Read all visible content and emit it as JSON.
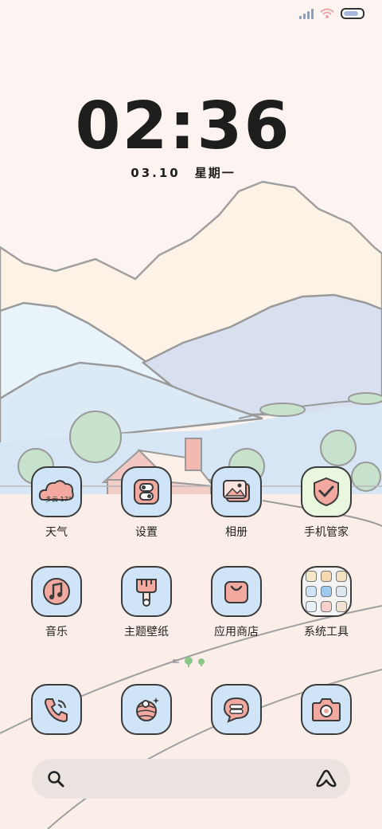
{
  "status_bar": {
    "icons": [
      "signal-icon",
      "wifi-icon",
      "battery-icon"
    ]
  },
  "clock": {
    "time": "02:36",
    "date": "03.10",
    "weekday": "星期一"
  },
  "apps": [
    {
      "label": "天气",
      "icon": "weather-icon",
      "badge": "多云 17°"
    },
    {
      "label": "设置",
      "icon": "settings-icon"
    },
    {
      "label": "相册",
      "icon": "gallery-icon"
    },
    {
      "label": "手机管家",
      "icon": "security-shield-icon"
    },
    {
      "label": "音乐",
      "icon": "music-icon"
    },
    {
      "label": "主题壁纸",
      "icon": "theme-brush-icon"
    },
    {
      "label": "应用商店",
      "icon": "store-bag-icon"
    },
    {
      "label": "系统工具",
      "icon": "folder-icon"
    }
  ],
  "dock": [
    {
      "icon": "phone-icon"
    },
    {
      "icon": "browser-planet-icon"
    },
    {
      "icon": "message-icon"
    },
    {
      "icon": "camera-icon"
    }
  ],
  "search_bar": {
    "left_icon": "search-icon",
    "right_icon": "assistant-icon"
  },
  "colors": {
    "icon_bg": "#cfe4f7",
    "accent_pink": "#f3a9a0",
    "outline": "#3b3b3b"
  }
}
